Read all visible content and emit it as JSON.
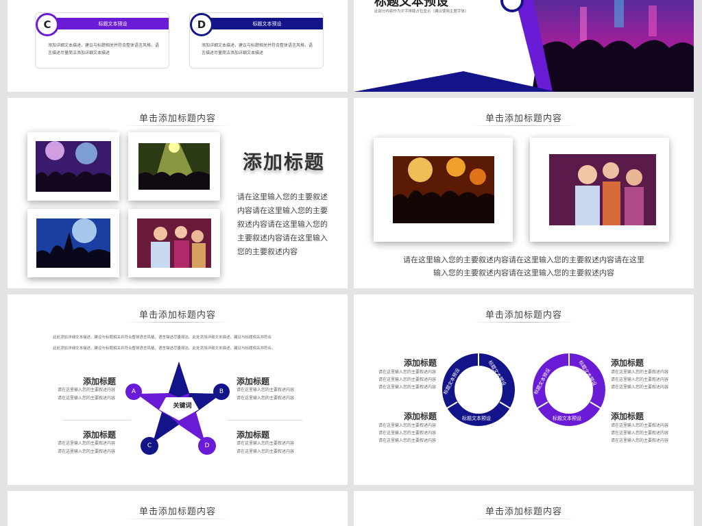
{
  "slide1": {
    "cards": [
      {
        "letter": "C",
        "bar_label": "标题文本预设",
        "text": "添加详细文本描述，建议与标题相关并符合整体语言风格，语言描述尽量简洁添加详细文本描述"
      },
      {
        "letter": "D",
        "bar_label": "标题文本预设",
        "text": "添加详细文本描述，建议与标题相关并符合整体语言风格，语言描述尽量简洁添加详细文本描述"
      }
    ]
  },
  "slide2": {
    "title": "标题文本预设",
    "subtitle": "此部分内容作为文字排版占位显示（建议使用主题字体）"
  },
  "slide3": {
    "title": "单击添加标题内容",
    "heading": "添加标题",
    "body": "请在这里输入您的主要叙述内容请在这里输入您的主要叙述内容请在这里输入您的主要叙述内容请在这里输入您的主要叙述内容"
  },
  "slide4": {
    "title": "单击添加标题内容",
    "caption_line1": "请在这里输入您的主要叙述内容请在这里输入您的主要叙述内容请在这里",
    "caption_line2": "输入您的主要叙述内容请在这里输入您的主要叙述内容"
  },
  "slide5": {
    "title": "单击添加标题内容",
    "intro_line1": "此处添加详细文本描述，建议与标题相关并符合整体语言风格，语言描述尽量简洁。此处添加详细文本描述，建议与标题相关并符合",
    "intro_line2": "此处添加详细文本描述，建议与标题相关并符合整体语言风格，语言描述尽量简洁。此处添加详细文本描述，建议与标题相关并符合。",
    "center_label": "关键词",
    "blocks": [
      {
        "heading": "添加标题",
        "line1": "请在这里输入您的主要叙述内容",
        "line2": "请在这里输入您的主要叙述内容"
      },
      {
        "heading": "添加标题",
        "line1": "请在这里输入您的主要叙述内容",
        "line2": "请在这里输入您的主要叙述内容"
      },
      {
        "heading": "添加标题",
        "line1": "请在这里输入您的主要叙述内容",
        "line2": "请在这里输入您的主要叙述内容"
      },
      {
        "heading": "添加标题",
        "line1": "请在这里输入您的主要叙述内容",
        "line2": "请在这里输入您的主要叙述内容"
      }
    ],
    "letters": [
      "A",
      "B",
      "C",
      "D"
    ]
  },
  "slide6": {
    "title": "单击添加标题内容",
    "ring_labels": [
      "标题文本预设",
      "标题文本预设",
      "标题文本预设"
    ],
    "blocks": [
      {
        "heading": "添加标题",
        "line1": "请在这里输入您的主要叙述内容",
        "line2": "请在这里输入您的主要叙述内容",
        "line3": "请在这里输入您的主要叙述内容"
      },
      {
        "heading": "添加标题",
        "line1": "请在这里输入您的主要叙述内容",
        "line2": "请在这里输入您的主要叙述内容",
        "line3": "请在这里输入您的主要叙述内容"
      },
      {
        "heading": "添加标题",
        "line1": "请在这里输入您的主要叙述内容",
        "line2": "请在这里输入您的主要叙述内容",
        "line3": "请在这里输入您的主要叙述内容"
      },
      {
        "heading": "添加标题",
        "line1": "请在这里输入您的主要叙述内容",
        "line2": "请在这里输入您的主要叙述内容",
        "line3": "请在这里输入您的主要叙述内容"
      }
    ]
  },
  "slide7": {
    "title": "单击添加标题内容"
  },
  "slide8": {
    "title": "单击添加标题内容"
  },
  "colors": {
    "purple": "#6a1bd6",
    "navy": "#14148a",
    "background": "#e3e3e3"
  }
}
